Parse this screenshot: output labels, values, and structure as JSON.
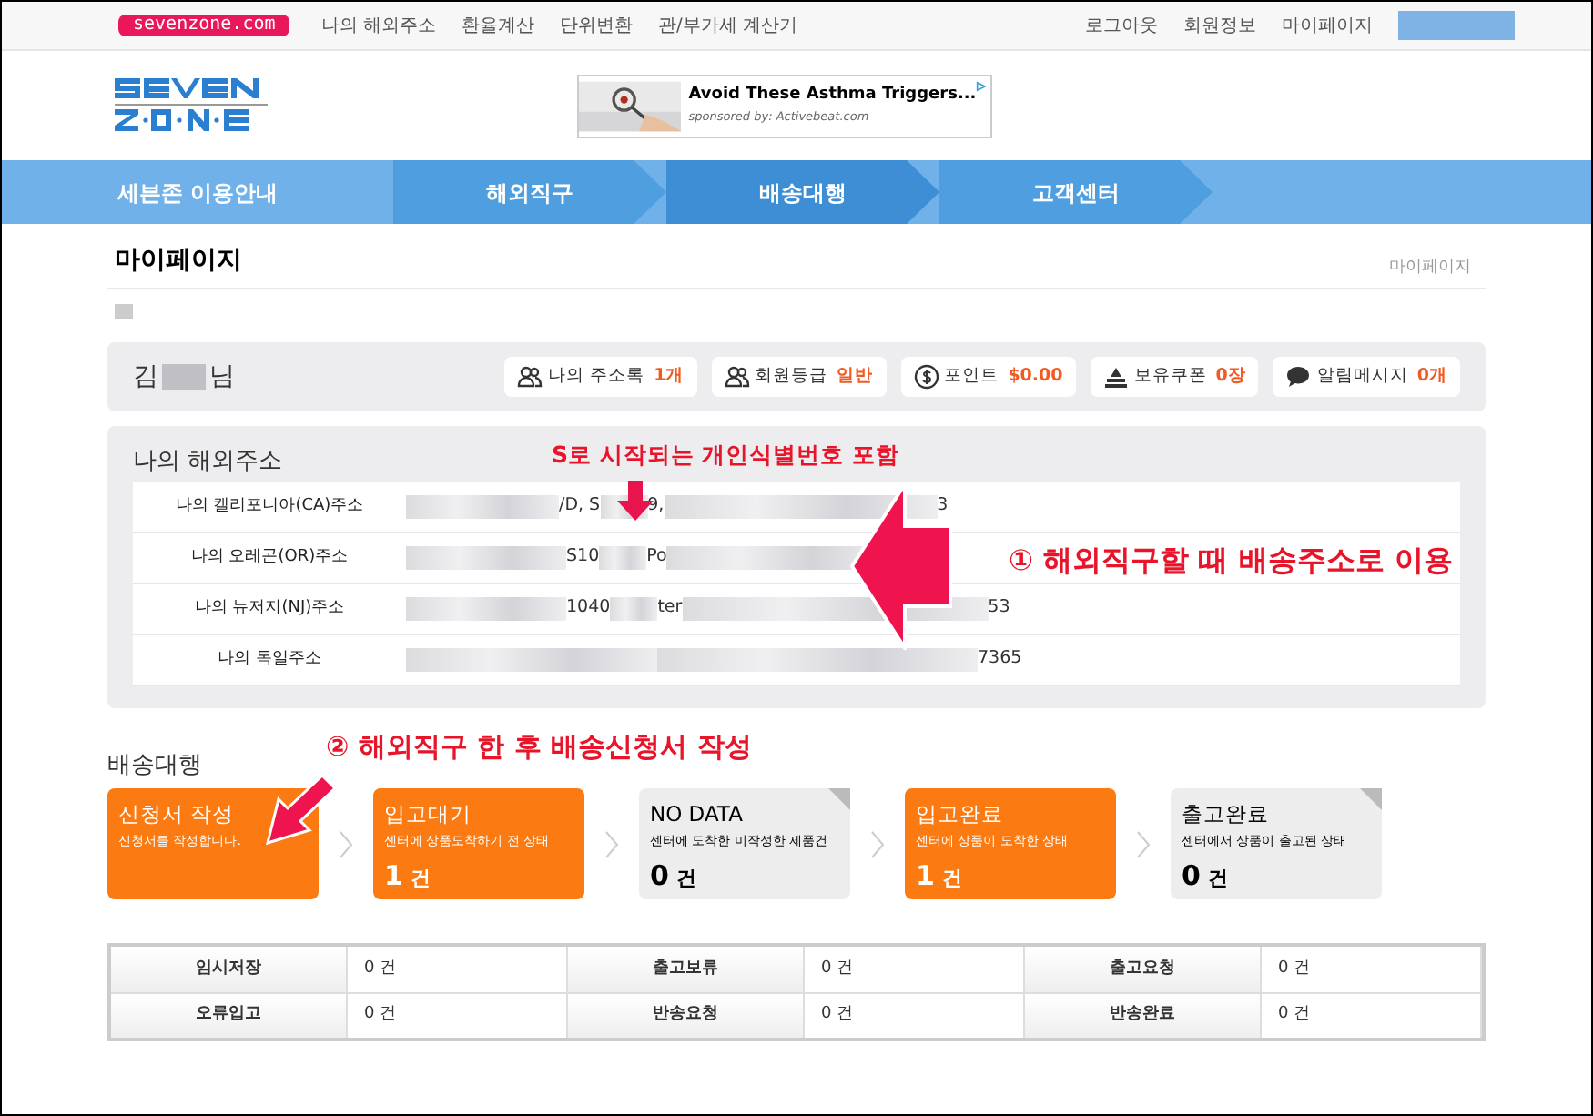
{
  "top_bar": {
    "brand": "sevenzone.com",
    "links": [
      "나의 해외주소",
      "환율계산",
      "단위변환",
      "관/부가세 계산기"
    ],
    "right_links": [
      "로그아웃",
      "회원정보",
      "마이페이지"
    ]
  },
  "ad": {
    "title": "Avoid These Asthma Triggers...",
    "sponsor": "sponsored by: Activebeat.com"
  },
  "nav": [
    {
      "label": "세븐존 이용안내",
      "selected": false
    },
    {
      "label": "해외직구",
      "selected": false
    },
    {
      "label": "배송대행",
      "selected": true
    },
    {
      "label": "고객센터",
      "selected": false
    }
  ],
  "page_title": "마이페이지",
  "breadcrumb": "마이페이지",
  "member": {
    "name_start": "김",
    "name_end": "님",
    "badges": [
      {
        "label": "나의 주소록",
        "value": "1개",
        "kind": "people"
      },
      {
        "label": "회원등급",
        "value": "일반",
        "kind": "people"
      },
      {
        "label": "포인트",
        "value": "$0.00",
        "kind": "coin"
      },
      {
        "label": "보유쿠폰",
        "value": "0장",
        "kind": "stack"
      },
      {
        "label": "알림메시지",
        "value": "0개",
        "kind": "chat"
      }
    ]
  },
  "addresses": {
    "title": "나의 해외주소",
    "rows": [
      {
        "label": "나의 캘리포니아(CA)주소",
        "segments": [
          {
            "kind": "blur"
          },
          {
            "kind": "text",
            "text": "/D, S"
          },
          {
            "kind": "blur"
          },
          {
            "kind": "text",
            "text": "9,"
          },
          {
            "kind": "blur"
          },
          {
            "kind": "text",
            "text": "3"
          }
        ]
      },
      {
        "label": "나의 오레곤(OR)주소",
        "segments": [
          {
            "kind": "blur"
          },
          {
            "kind": "text",
            "text": "S10"
          },
          {
            "kind": "blur"
          },
          {
            "kind": "text",
            "text": "Po"
          },
          {
            "kind": "blur"
          }
        ]
      },
      {
        "label": "나의 뉴저지(NJ)주소",
        "segments": [
          {
            "kind": "blur"
          },
          {
            "kind": "text",
            "text": "1040"
          },
          {
            "kind": "blur"
          },
          {
            "kind": "text",
            "text": "ter"
          },
          {
            "kind": "blur"
          },
          {
            "kind": "text",
            "text": "53"
          }
        ]
      },
      {
        "label": "나의 독일주소",
        "segments": [
          {
            "kind": "blur"
          },
          {
            "kind": "blur"
          },
          {
            "kind": "text",
            "text": "7365"
          }
        ]
      }
    ]
  },
  "annotations": [
    "S로 시작되는 개인식별번호 포함",
    "① 해외직구할 때 배송주소로 이용",
    "② 해외직구 한 후 배송신청서 작성"
  ],
  "shipping": {
    "title": "배송대행",
    "stages": [
      {
        "title": "신청서 작성",
        "desc": "신청서를 작성합니다.",
        "highlighted": true
      },
      {
        "title": "입고대기",
        "desc": "센터에 상품도착하기 전 상태",
        "count": "1",
        "unit": "건",
        "highlighted": true
      },
      {
        "title": "NO DATA",
        "desc": "센터에 도착한 미작성한 제품건",
        "count": "0",
        "unit": "건",
        "highlighted": false
      },
      {
        "title": "입고완료",
        "desc": "센터에 상품이 도착한 상태",
        "count": "1",
        "unit": "건",
        "highlighted": true
      },
      {
        "title": "출고완료",
        "desc": "센터에서 상품이 출고된 상태",
        "count": "0",
        "unit": "건",
        "highlighted": false
      }
    ]
  },
  "status_table": [
    [
      {
        "label": "임시저장",
        "value": "0 건"
      },
      {
        "label": "출고보류",
        "value": "0 건"
      },
      {
        "label": "출고요청",
        "value": "0 건"
      }
    ],
    [
      {
        "label": "오류입고",
        "value": "0 건"
      },
      {
        "label": "반송요청",
        "value": "0 건"
      },
      {
        "label": "반송완료",
        "value": "0 건"
      }
    ]
  ]
}
